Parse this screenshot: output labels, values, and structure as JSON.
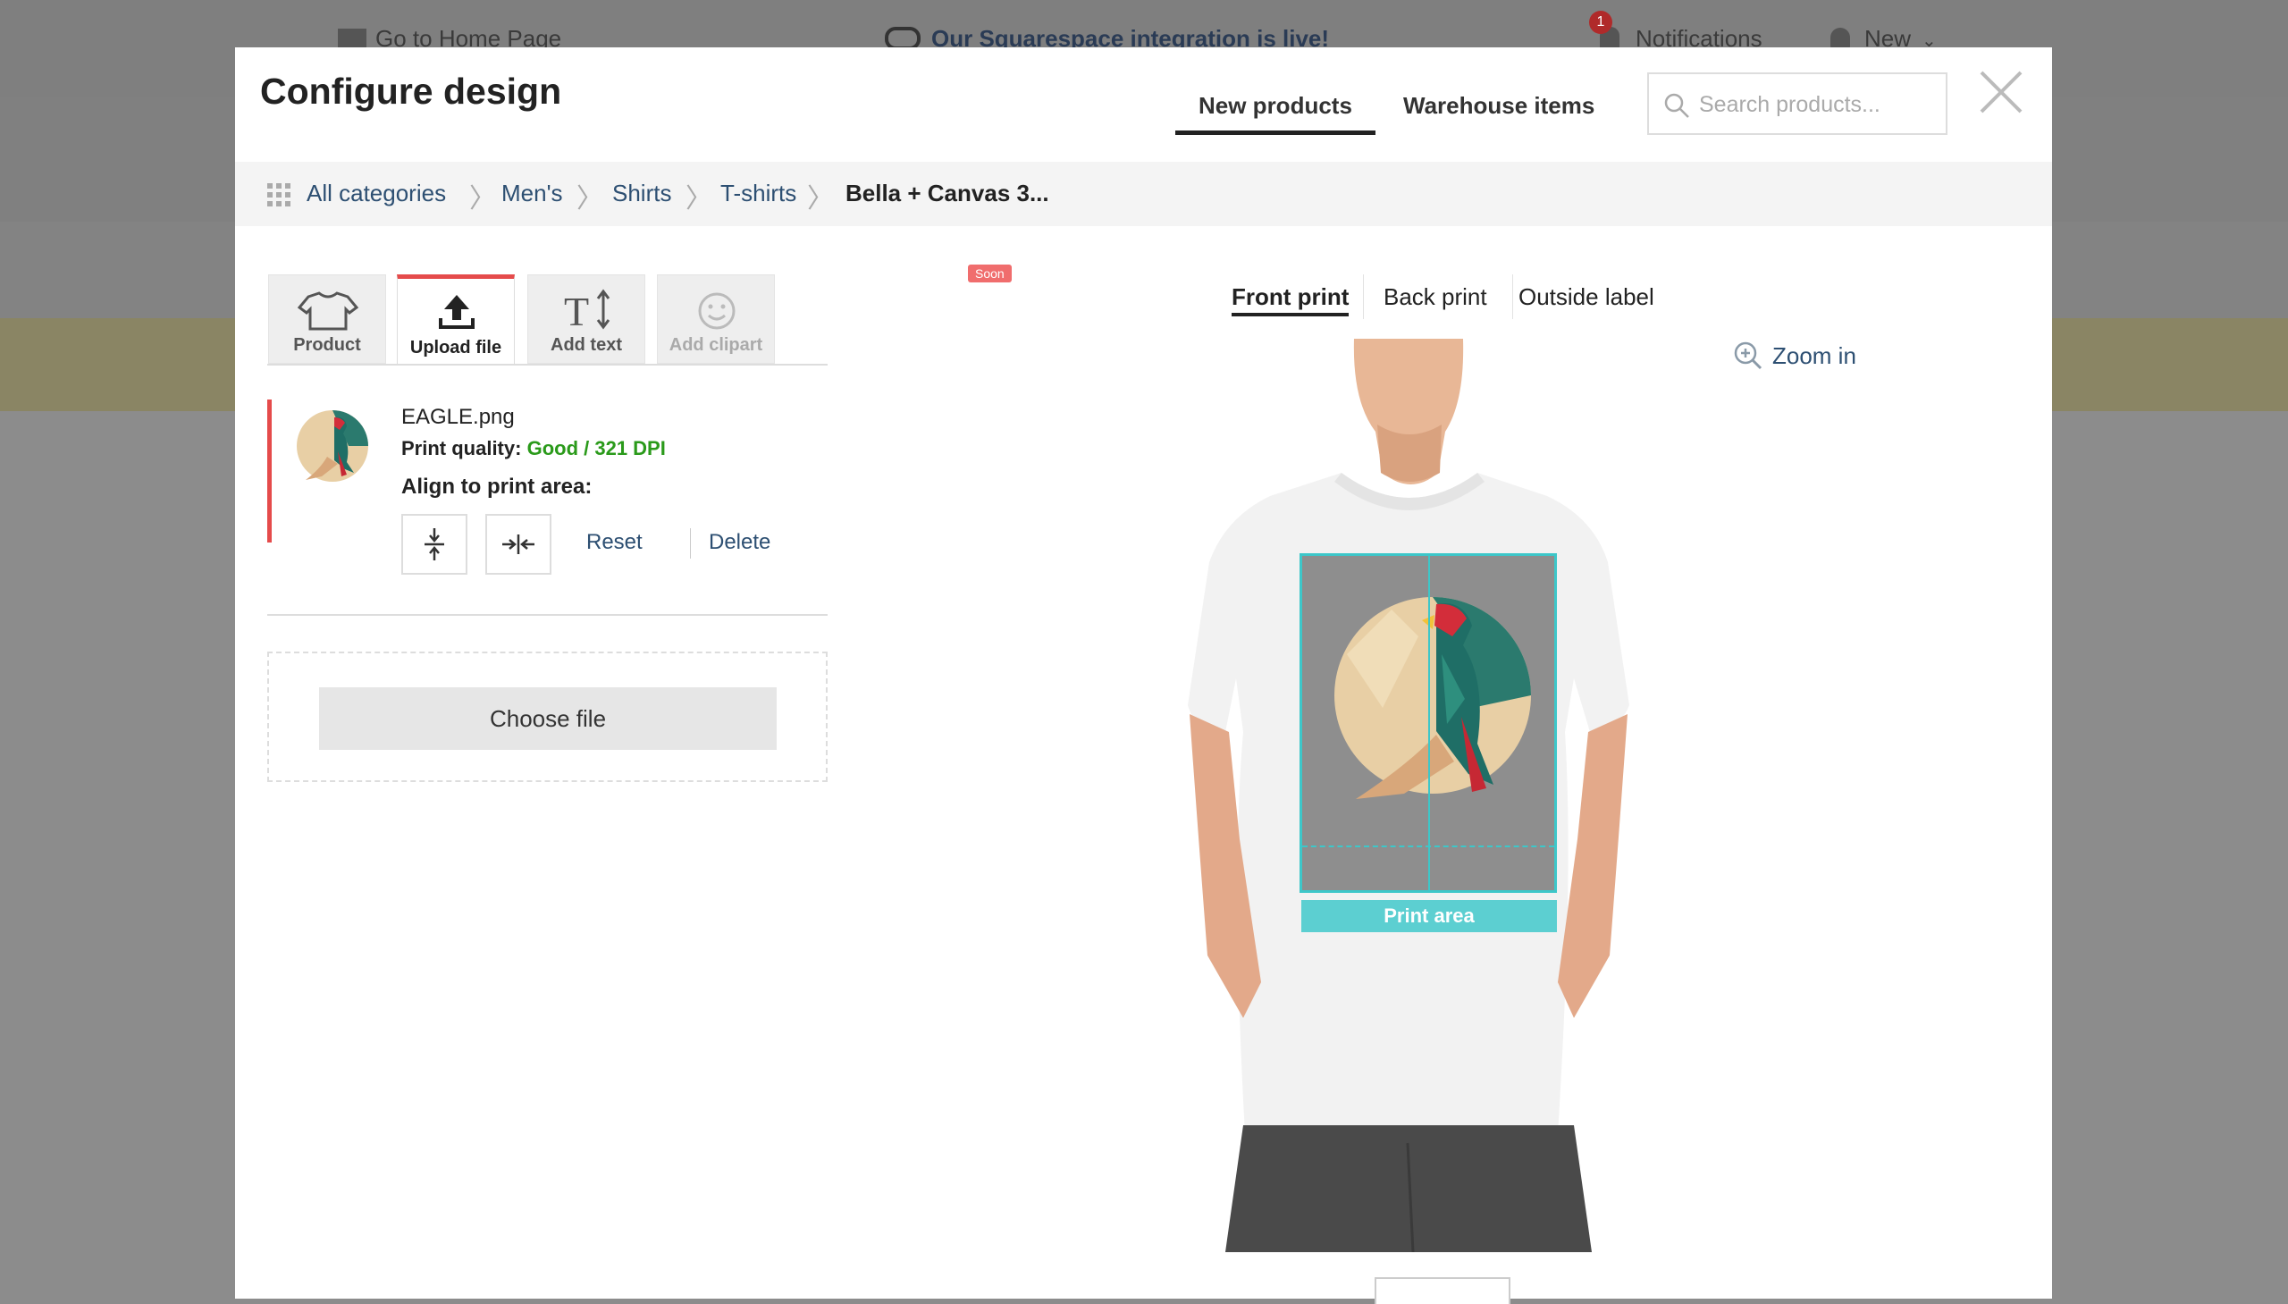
{
  "background": {
    "home_link": "Go to Home Page",
    "announcement": "Our Squarespace integration is live!",
    "notifications": "Notifications",
    "notification_count": "1",
    "new_menu": "New"
  },
  "modal": {
    "title": "Configure design",
    "tabs": [
      {
        "label": "New products",
        "active": true
      },
      {
        "label": "Warehouse items",
        "active": false
      }
    ],
    "search_placeholder": "Search products...",
    "breadcrumbs": [
      "All categories",
      "Men's",
      "Shirts",
      "T-shirts",
      "Bella + Canvas 3..."
    ],
    "tools": [
      {
        "label": "Product",
        "icon": "tshirt-icon",
        "active": false
      },
      {
        "label": "Upload file",
        "icon": "upload-icon",
        "active": true
      },
      {
        "label": "Add text",
        "icon": "text-icon",
        "active": false
      },
      {
        "label": "Add clipart",
        "icon": "smiley-icon",
        "active": false,
        "badge": "Soon"
      }
    ],
    "file": {
      "name": "EAGLE.png",
      "quality_label": "Print quality:",
      "quality_value": "Good / 321 DPI",
      "align_label": "Align to print area:",
      "reset": "Reset",
      "delete": "Delete"
    },
    "choose_file": "Choose file",
    "print_tabs": [
      {
        "label": "Front print",
        "active": true
      },
      {
        "label": "Back print",
        "active": false
      },
      {
        "label": "Outside label",
        "active": false
      }
    ],
    "zoom": "Zoom in",
    "print_area_label": "Print area"
  },
  "colors": {
    "accent_red": "#e54b4b",
    "link_blue": "#2d4f72",
    "quality_green": "#2a9a1a",
    "print_area_cyan": "#3dc7c9"
  }
}
